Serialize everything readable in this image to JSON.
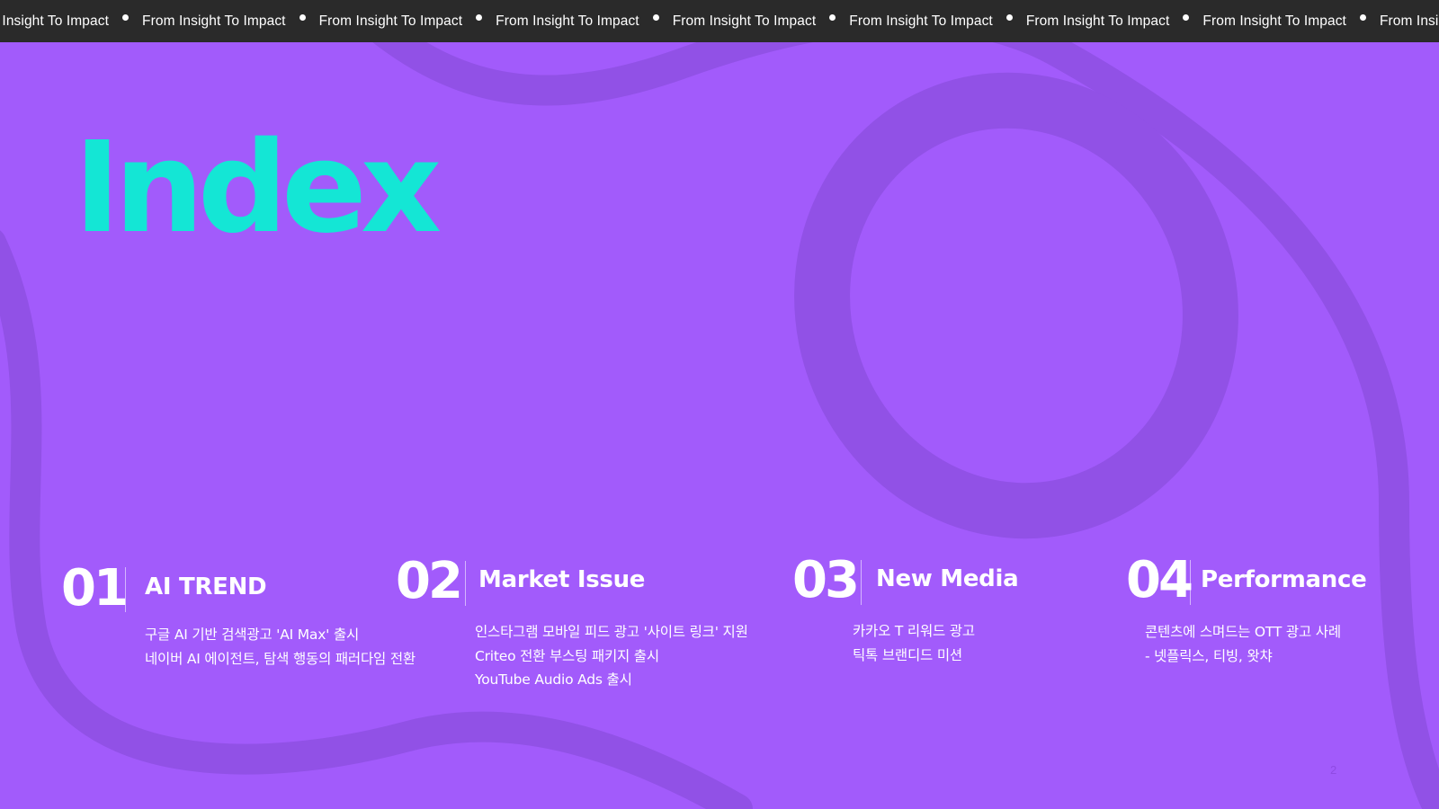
{
  "ticker": {
    "text": "From Insight To Impact",
    "items": [
      "m Insight To Impact",
      "From Insight To Impact",
      "From Insight To Impact",
      "From Insight To Impact",
      "From Insight To Impact",
      "From Insight To Impact",
      "From Insight To Impact",
      "From Insight To Impact",
      "From Insight To"
    ]
  },
  "title": "Index",
  "sections": [
    {
      "number": "01",
      "name": "AI TREND",
      "items": [
        "구글 AI 기반 검색광고 'AI Max' 출시",
        "네이버 AI 에이전트, 탐색 행동의 패러다임 전환"
      ]
    },
    {
      "number": "02",
      "name": "Market Issue",
      "items": [
        "인스타그램 모바일 피드 광고 '사이트 링크' 지원",
        "Criteo 전환 부스팅 패키지 출시",
        "YouTube Audio Ads 출시"
      ]
    },
    {
      "number": "03",
      "name": "New Media",
      "items": [
        "카카오 T 리워드 광고",
        "틱톡 브랜디드 미션"
      ]
    },
    {
      "number": "04",
      "name": "Performance",
      "items": [
        "콘텐츠에 스며드는 OTT 광고 사례",
        "- 넷플릭스, 티빙, 왓챠"
      ]
    }
  ],
  "page_number": "2",
  "colors": {
    "background": "#a25bfb",
    "accent": "#14e6d5",
    "ticker_bg": "#2a2a2a",
    "shape": "#9151e6"
  }
}
